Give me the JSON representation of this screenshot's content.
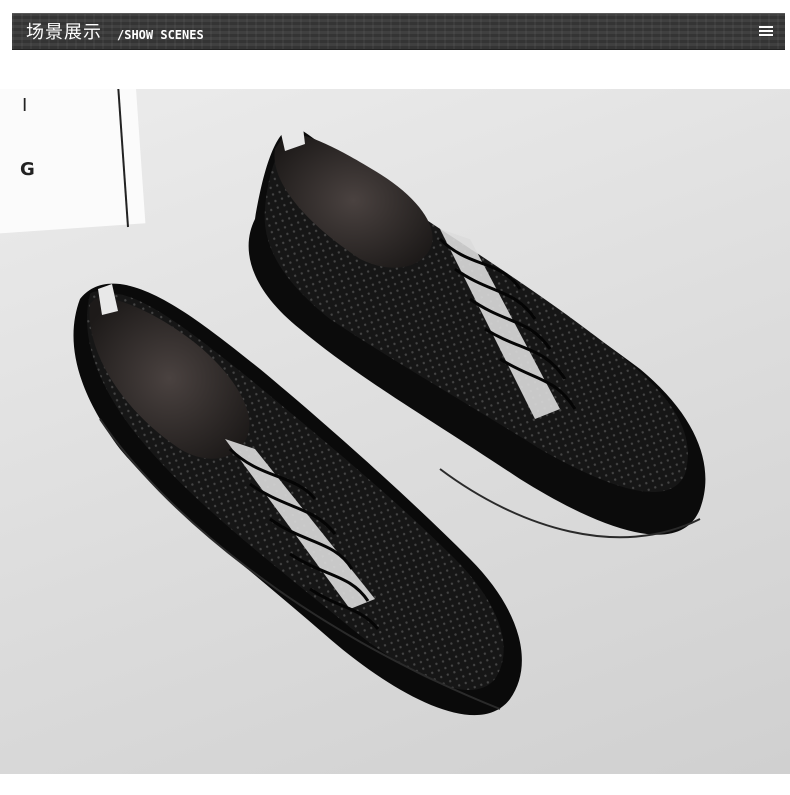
{
  "header": {
    "title": "场景展示",
    "subtitle": "/SHOW SCENES",
    "menu_icon": "menu-icon"
  },
  "scene": {
    "card_letters": [
      "I",
      "G"
    ],
    "product_image": "black-perforated-sneakers-photo",
    "colors": {
      "background": "#dcdcdc",
      "shoe": "#111111",
      "header": "#3a3a3a"
    }
  }
}
